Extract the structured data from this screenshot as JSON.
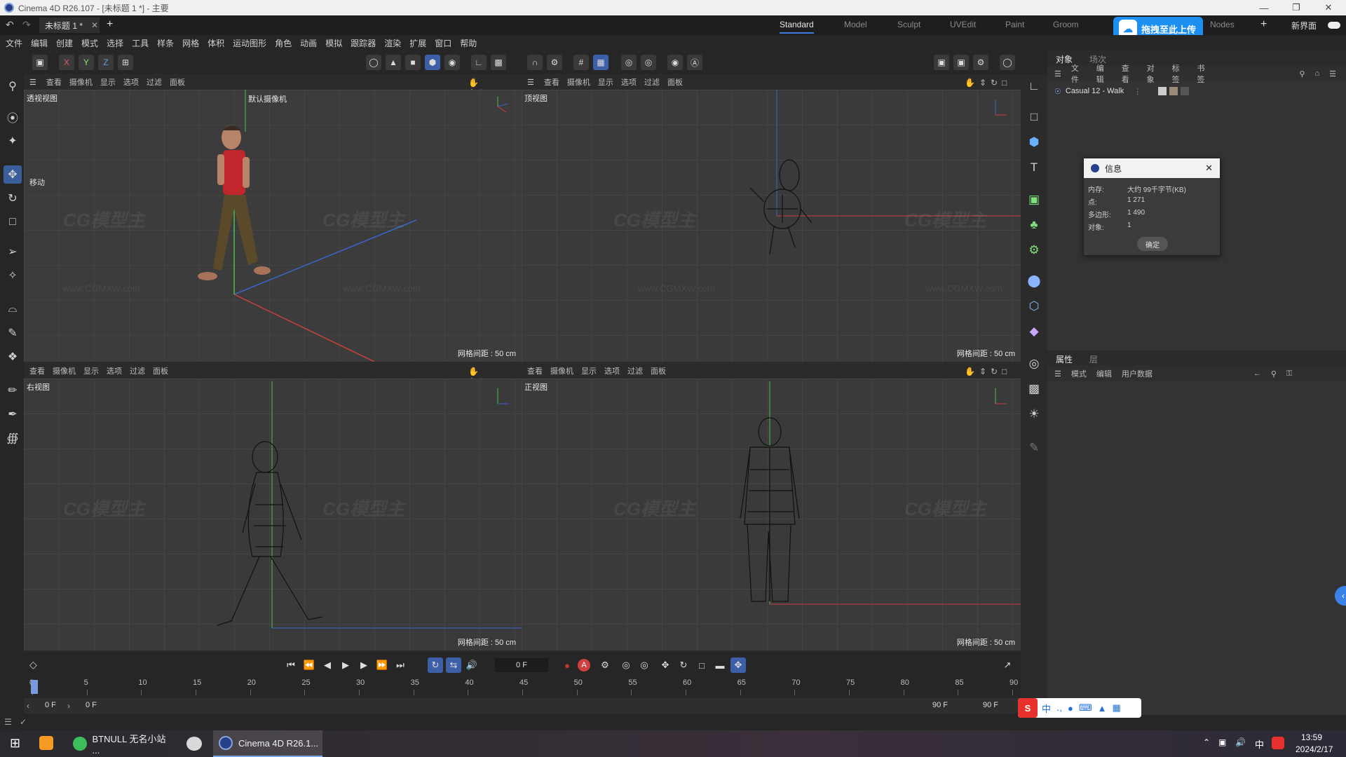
{
  "window": {
    "title": "Cinema 4D R26.107 - [未标题 1 *] - 主要"
  },
  "tabs": {
    "document_tab": "未标题 1 *",
    "layouts": [
      "Standard",
      "Model",
      "Sculpt",
      "UVEdit",
      "Paint",
      "Groom",
      "Nodes"
    ],
    "active_layout": "Standard",
    "new_layout": "新界面",
    "upload_label": "拖拽至此上传"
  },
  "menu": [
    "文件",
    "编辑",
    "创建",
    "模式",
    "选择",
    "工具",
    "样条",
    "网格",
    "体积",
    "运动图形",
    "角色",
    "动画",
    "模拟",
    "跟踪器",
    "渲染",
    "扩展",
    "窗口",
    "帮助"
  ],
  "toolbar": {
    "axis_x": "X",
    "axis_y": "Y",
    "axis_z": "Z"
  },
  "viewports": {
    "menu": [
      "查看",
      "摄像机",
      "显示",
      "选项",
      "过滤",
      "面板"
    ],
    "perspective": {
      "name": "透视视图",
      "camera": "默认摄像机",
      "tool": "移动",
      "grid": "网格间距 : 50 cm"
    },
    "top": {
      "name": "顶视图",
      "grid": "网格间距 : 50 cm"
    },
    "right": {
      "name": "右视图",
      "grid": "网格间距 : 50 cm"
    },
    "front": {
      "name": "正视图",
      "grid": "网格间距 : 50 cm"
    }
  },
  "watermark": {
    "logo": "CG模型主",
    "url": "www.CGMXW.com"
  },
  "object_manager": {
    "tabs": [
      "对象",
      "场次"
    ],
    "menu": [
      "文件",
      "编辑",
      "查看",
      "对象",
      "标签",
      "书签"
    ],
    "object_name": "Casual 12 - Walk"
  },
  "attributes": {
    "tabs": [
      "属性",
      "层"
    ],
    "menu": [
      "模式",
      "编辑",
      "用户数据"
    ]
  },
  "info_dialog": {
    "title": "信息",
    "memory_label": "内存:",
    "memory_value": "大约 99千字节(KB)",
    "points_label": "点:",
    "points_value": "1 271",
    "polygons_label": "多边形:",
    "polygons_value": "1 490",
    "objects_label": "对象:",
    "objects_value": "1",
    "ok_label": "确定"
  },
  "timeline": {
    "current_frame": "0 F",
    "start_field": "0 F",
    "start_field2": "0 F",
    "end_field": "90 F",
    "end_field2": "90 F",
    "ruler": [
      "0",
      "5",
      "10",
      "15",
      "20",
      "25",
      "30",
      "35",
      "40",
      "45",
      "50",
      "55",
      "60",
      "65",
      "70",
      "75",
      "80",
      "85",
      "90"
    ]
  },
  "taskbar": {
    "app1": "BTNULL 无名小站 ...",
    "app2": "Cinema 4D R26.1...",
    "time": "13:59",
    "date": "2024/2/17",
    "ime_lang": "中"
  },
  "ime_bar": {
    "lang": "中"
  }
}
